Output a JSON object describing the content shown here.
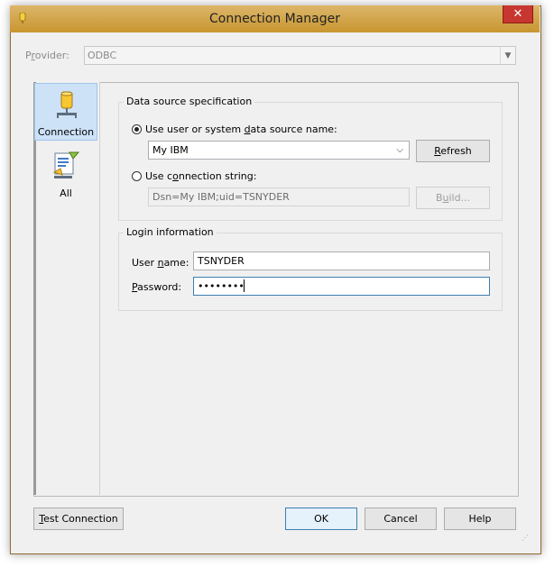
{
  "window": {
    "title": "Connection Manager",
    "close_glyph": "✕"
  },
  "provider": {
    "label": "Provider:",
    "value": "ODBC"
  },
  "nav": [
    {
      "label": "Connection",
      "icon": "database-icon",
      "selected": true
    },
    {
      "label": "All",
      "icon": "properties-icon",
      "selected": false
    }
  ],
  "datasource": {
    "group_title": "Data source specification",
    "option_dsn": "Use user or system data source name:",
    "dsn_value": "My IBM",
    "refresh_label": "Refresh",
    "option_connstr": "Use connection string:",
    "connstr_value": "Dsn=My IBM;uid=TSNYDER",
    "build_label": "Build..."
  },
  "login": {
    "group_title": "Login information",
    "user_label": "User name:",
    "user_value": "TSNYDER",
    "password_label": "Password:",
    "password_value": "••••••••"
  },
  "buttons": {
    "test": "Test Connection",
    "ok": "OK",
    "cancel": "Cancel",
    "help": "Help"
  },
  "colors": {
    "titlebar": "#c8962f",
    "close": "#c7372f",
    "selection": "#cde2f7",
    "focus": "#3c7fb1"
  }
}
